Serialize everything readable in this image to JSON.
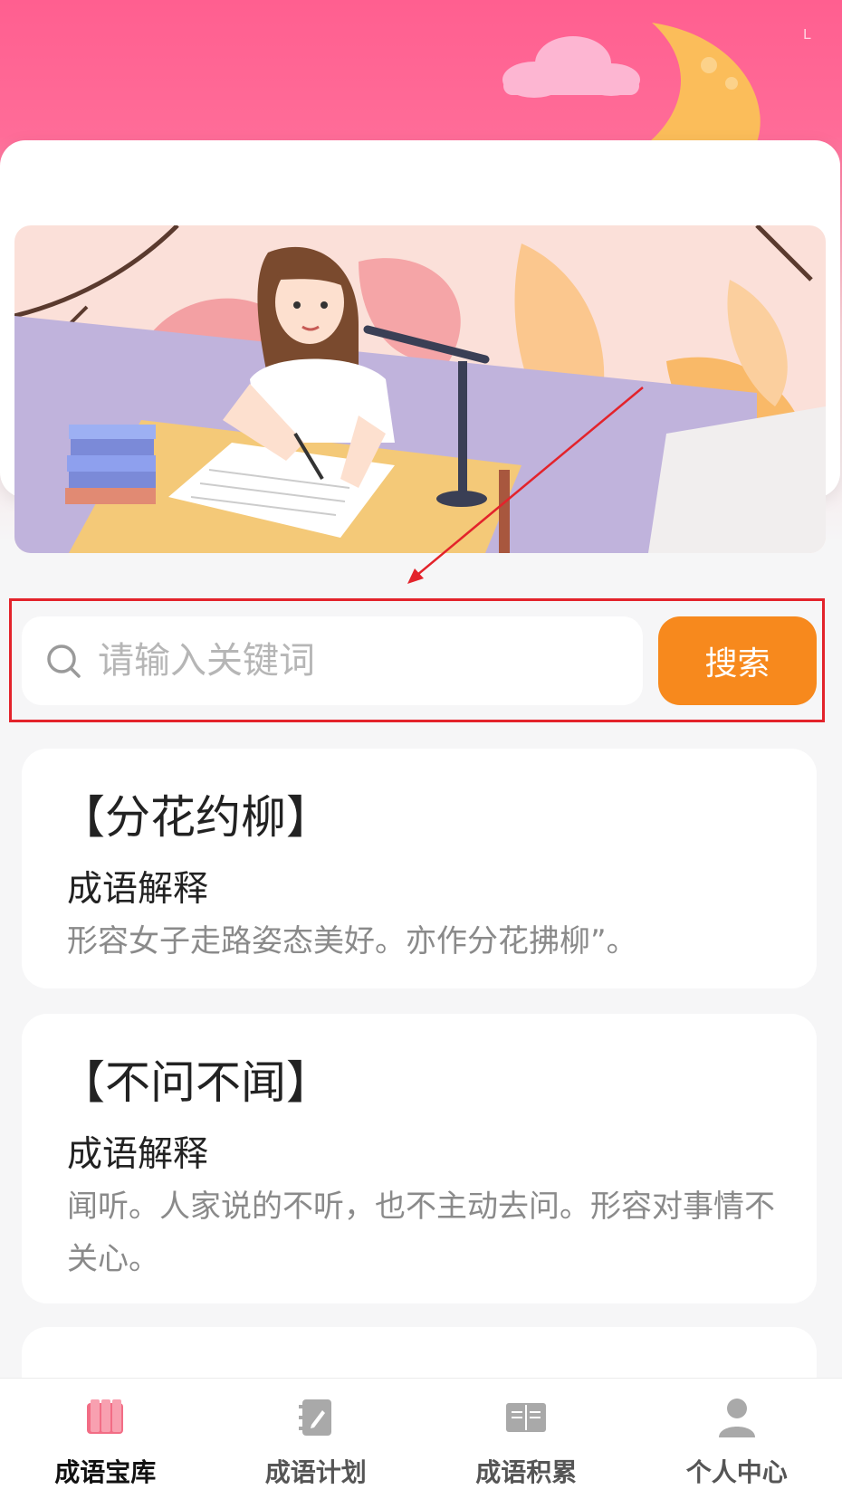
{
  "status_indicator": "L",
  "search": {
    "placeholder": "请输入关键词",
    "button_label": "搜索"
  },
  "idioms": [
    {
      "title": "【分花约柳】",
      "subtitle": "成语解释",
      "description": "形容女子走路姿态美好。亦作分花拂柳”。"
    },
    {
      "title": "【不问不闻】",
      "subtitle": "成语解释",
      "description": "闻听。人家说的不听，也不主动去问。形容对事情不关心。"
    }
  ],
  "bottom_nav": {
    "items": [
      {
        "label": "成语宝库",
        "icon": "book-icon",
        "active": true
      },
      {
        "label": "成语计划",
        "icon": "notebook-edit-icon",
        "active": false
      },
      {
        "label": "成语积累",
        "icon": "open-book-icon",
        "active": false
      },
      {
        "label": "个人中心",
        "icon": "user-icon",
        "active": false
      }
    ]
  },
  "colors": {
    "header_pink": "#ff5f90",
    "search_button": "#f7891d",
    "highlight_annotation": "#e3232b",
    "nav_active_icon": "#f26d85",
    "nav_inactive_icon": "#a9a9a9"
  }
}
